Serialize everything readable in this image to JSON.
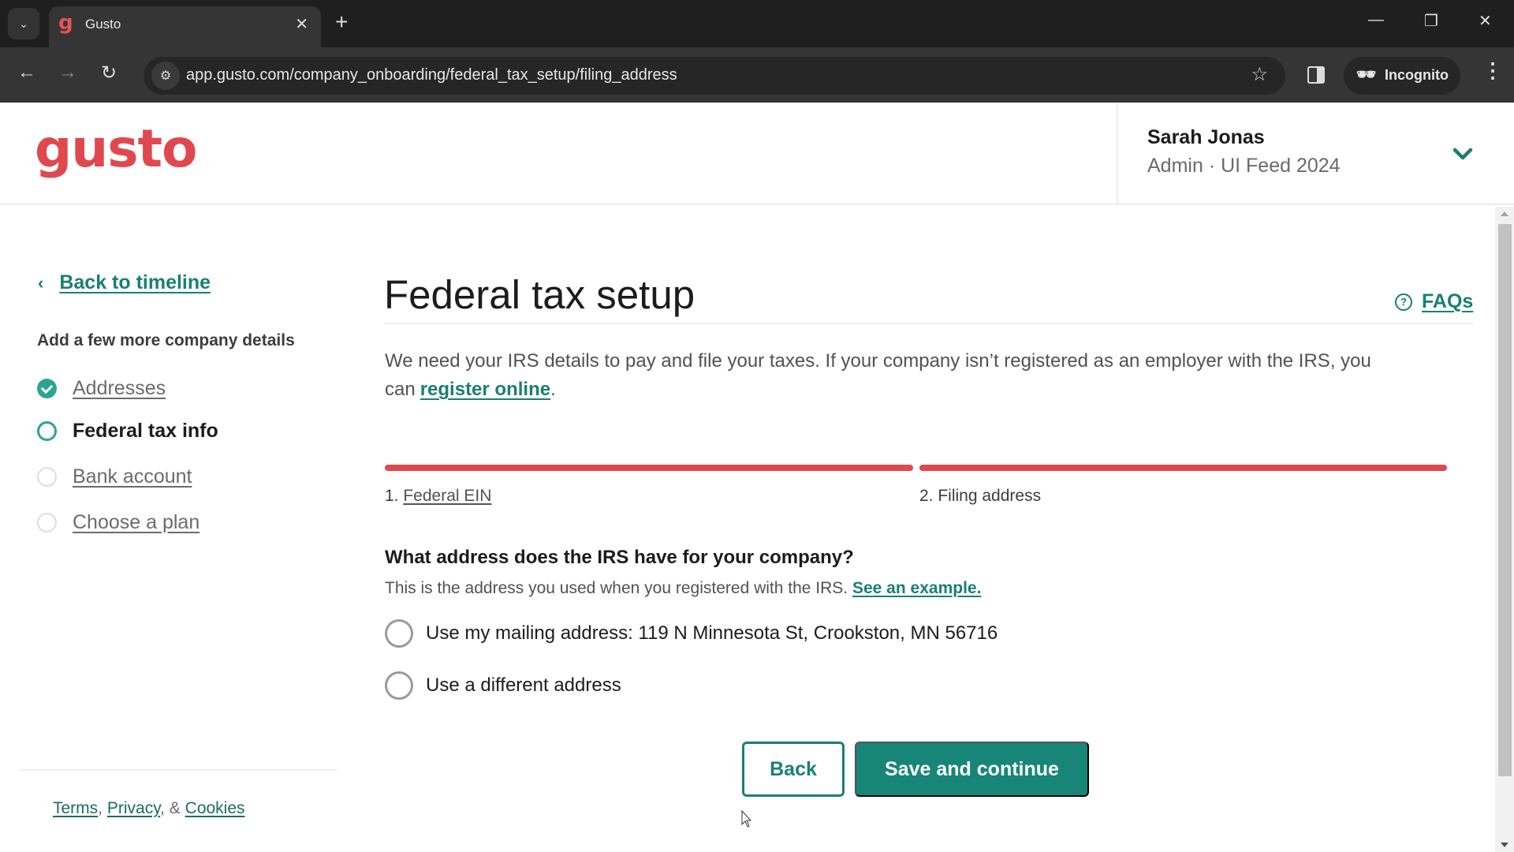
{
  "browser": {
    "tab_title": "Gusto",
    "tab_favicon": "g",
    "url": "app.gusto.com/company_onboarding/federal_tax_setup/filing_address",
    "incognito_label": "Incognito",
    "icons": {
      "tab_search": "⌄",
      "close_tab": "✕",
      "new_tab": "+",
      "minimize": "—",
      "restore": "❐",
      "close_window": "✕",
      "back": "←",
      "forward": "→",
      "reload": "↻",
      "site_info": "⚙",
      "bookmark_star": "☆",
      "incognito": "🕶",
      "menu": "⋮"
    }
  },
  "header": {
    "logo_text": "gusto",
    "user_name": "Sarah Jonas",
    "user_role_company": "Admin · UI Feed 2024"
  },
  "sidebar": {
    "back_chevron": "‹",
    "back_link": "Back to timeline",
    "heading": "Add a few more company details",
    "items": [
      {
        "label": "Addresses",
        "status": "complete"
      },
      {
        "label": "Federal tax info",
        "status": "current"
      },
      {
        "label": "Bank account",
        "status": "incomplete"
      },
      {
        "label": "Choose a plan",
        "status": "incomplete"
      }
    ],
    "footer": {
      "terms": "Terms",
      "sep1": ", ",
      "privacy": "Privacy",
      "sep2": ", & ",
      "cookies": "Cookies"
    }
  },
  "main": {
    "title": "Federal tax setup",
    "faqs_icon": "?",
    "faqs_label": "FAQs",
    "intro_text": "We need your IRS details to pay and file your taxes. If your company isn’t registered as an employer with the IRS, you can",
    "intro_link": "register online",
    "intro_end": ".",
    "steps": [
      {
        "number": "1.",
        "label": "Federal EIN",
        "progress": 1.0,
        "linked": true
      },
      {
        "number": "2.",
        "label": "Filing address",
        "progress": 1.0,
        "linked": false
      }
    ],
    "question": "What address does the IRS have for your company?",
    "question_help": "This is the address you used when you registered with the IRS.",
    "question_help_link": "See an example.",
    "options": [
      {
        "label": "Use my mailing address: 119 N Minnesota St, Crookston, MN 56716",
        "selected": false
      },
      {
        "label": "Use a different address",
        "selected": false
      }
    ],
    "back_button": "Back",
    "save_button": "Save and continue"
  },
  "colors": {
    "brand_red": "#e0484f",
    "accent_teal": "#1a7f73",
    "button_teal": "#178679",
    "check_teal": "#2aa592"
  }
}
